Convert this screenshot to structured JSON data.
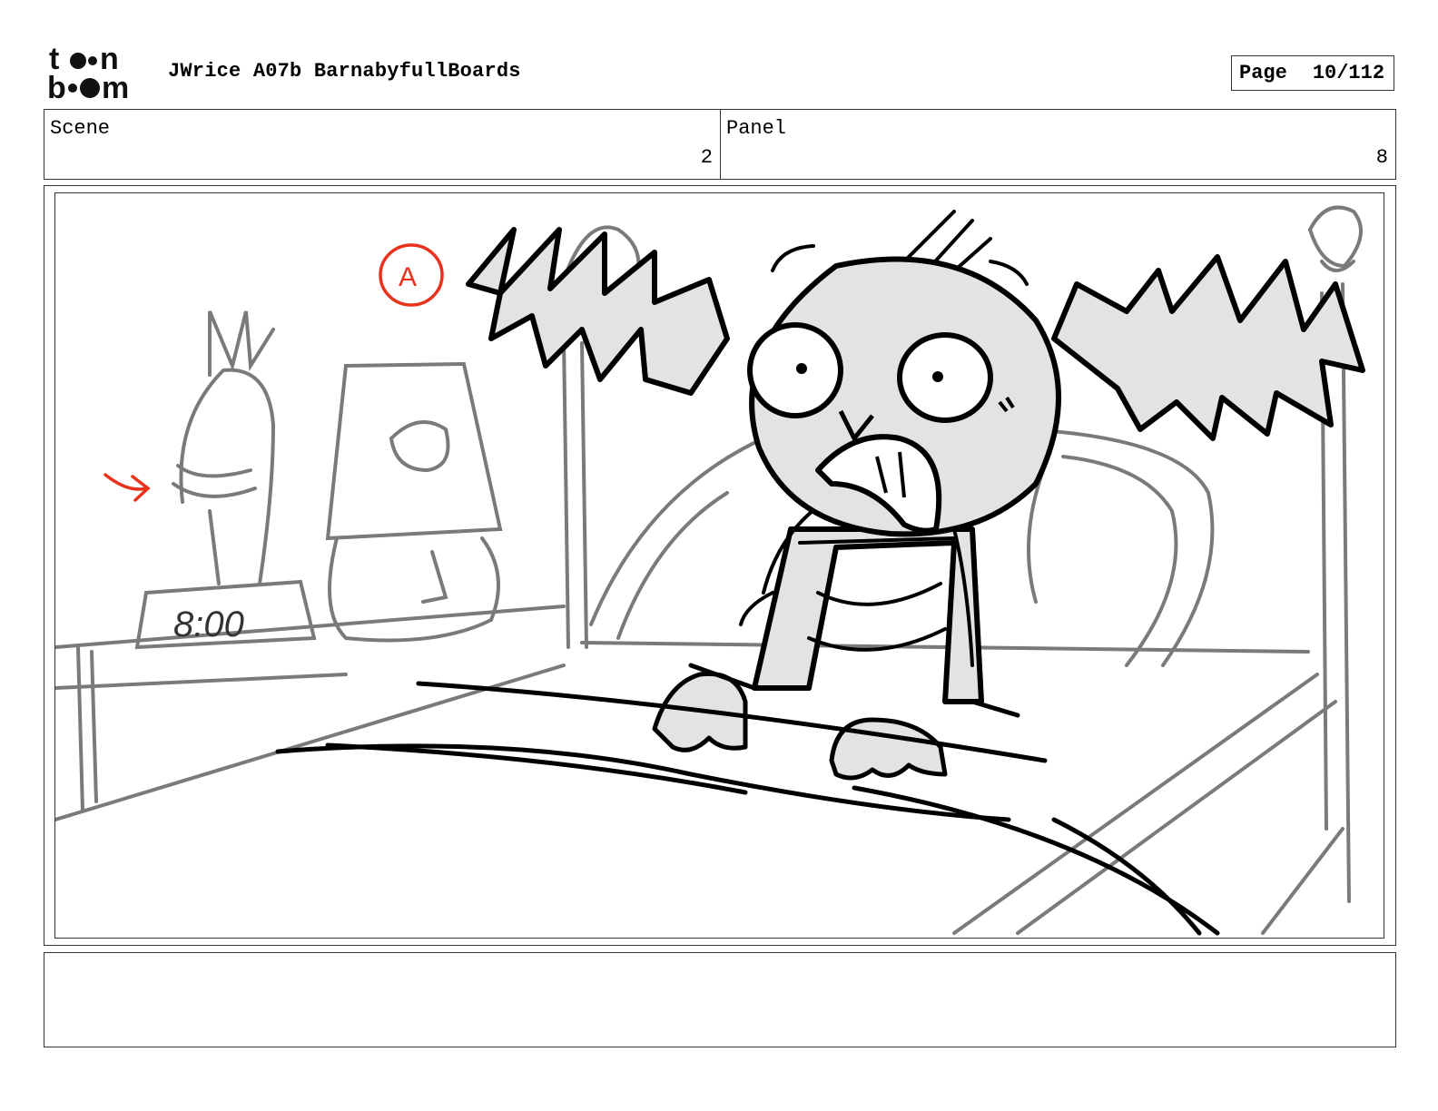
{
  "header": {
    "logo_text": "toon boom",
    "title": "JWrice A07b BarnabyfullBoards",
    "page_label": "Page",
    "page_value": "10/112"
  },
  "info": {
    "scene_label": "Scene",
    "scene_value": "2",
    "panel_label": "Panel",
    "panel_value": "8"
  },
  "sketch": {
    "annotation_letter": "A",
    "clock_text": "8:00",
    "colors": {
      "ink": "#000000",
      "pencil": "#7a7a7a",
      "fill": "#e3e3e3",
      "annotation": "#e8321c"
    }
  },
  "notes": {
    "text": ""
  }
}
